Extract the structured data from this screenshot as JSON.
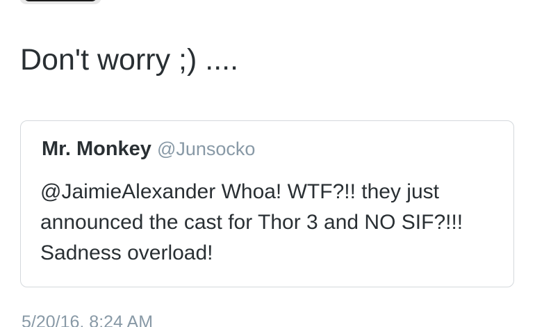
{
  "tweet": {
    "text": "Don't worry ;) ....",
    "timestamp": "5/20/16, 8:24 AM"
  },
  "quoted_tweet": {
    "name": "Mr. Monkey",
    "handle": "@Junsocko",
    "text": "@JaimieAlexander Whoa! WTF?!! they just announced the cast for Thor 3 and NO SIF?!!! Sadness overload!"
  },
  "colors": {
    "text": "#292f33",
    "secondary_text": "#8899a6",
    "card_border": "#d4d8dc"
  }
}
